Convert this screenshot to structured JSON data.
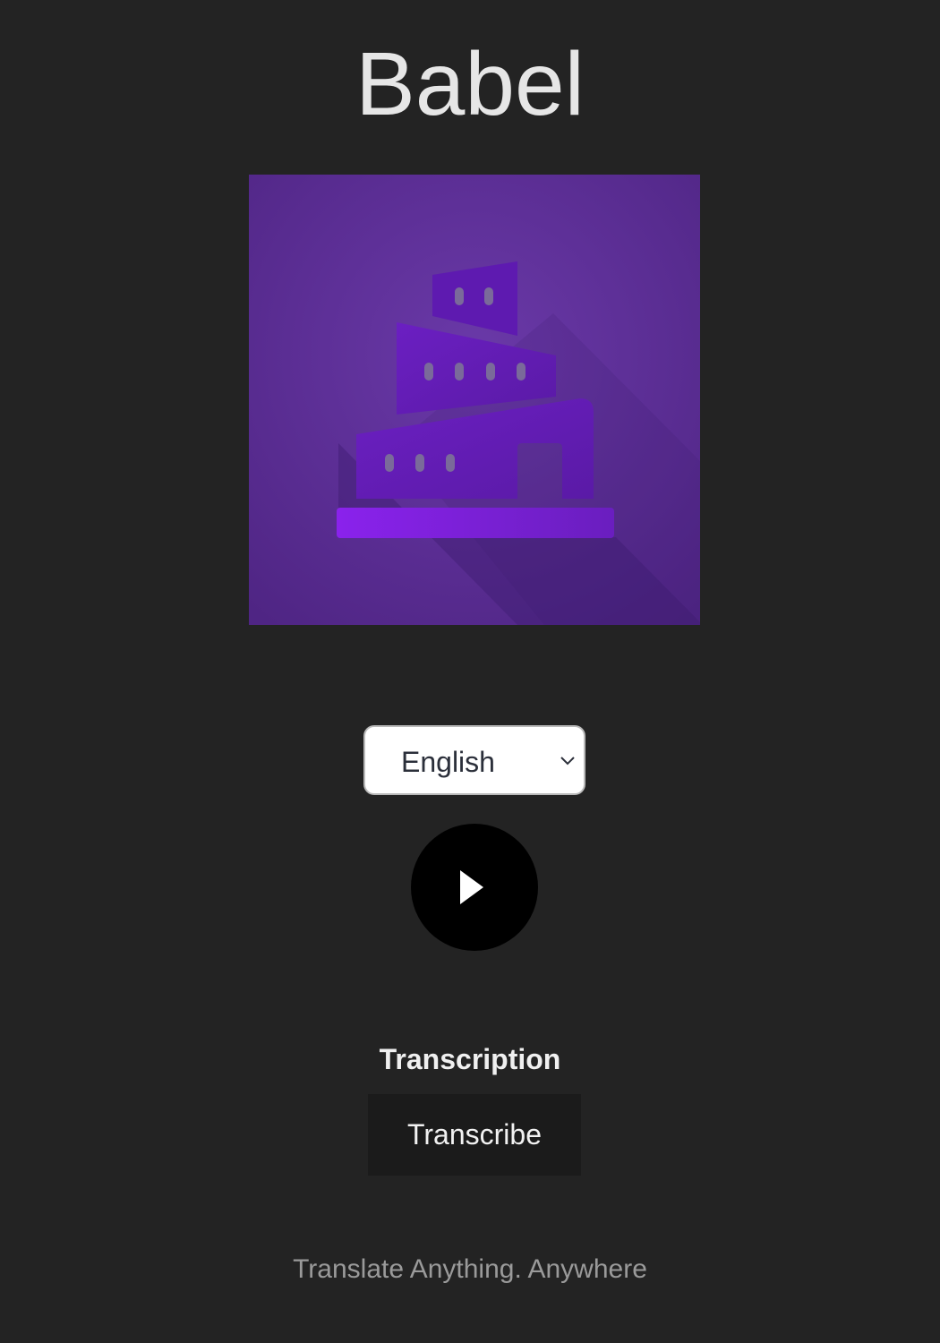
{
  "header": {
    "title": "Babel"
  },
  "logo": {
    "icon": "tower-of-babel-icon",
    "background_color": "#5b2d94",
    "tower_color": "#7a1fd6"
  },
  "language_select": {
    "selected": "English",
    "icon": "chevron-down-icon"
  },
  "player": {
    "icon": "play-icon"
  },
  "transcription": {
    "heading": "Transcription",
    "button_label": "Transcribe"
  },
  "footer": {
    "tagline": "Translate Anything. Anywhere"
  }
}
